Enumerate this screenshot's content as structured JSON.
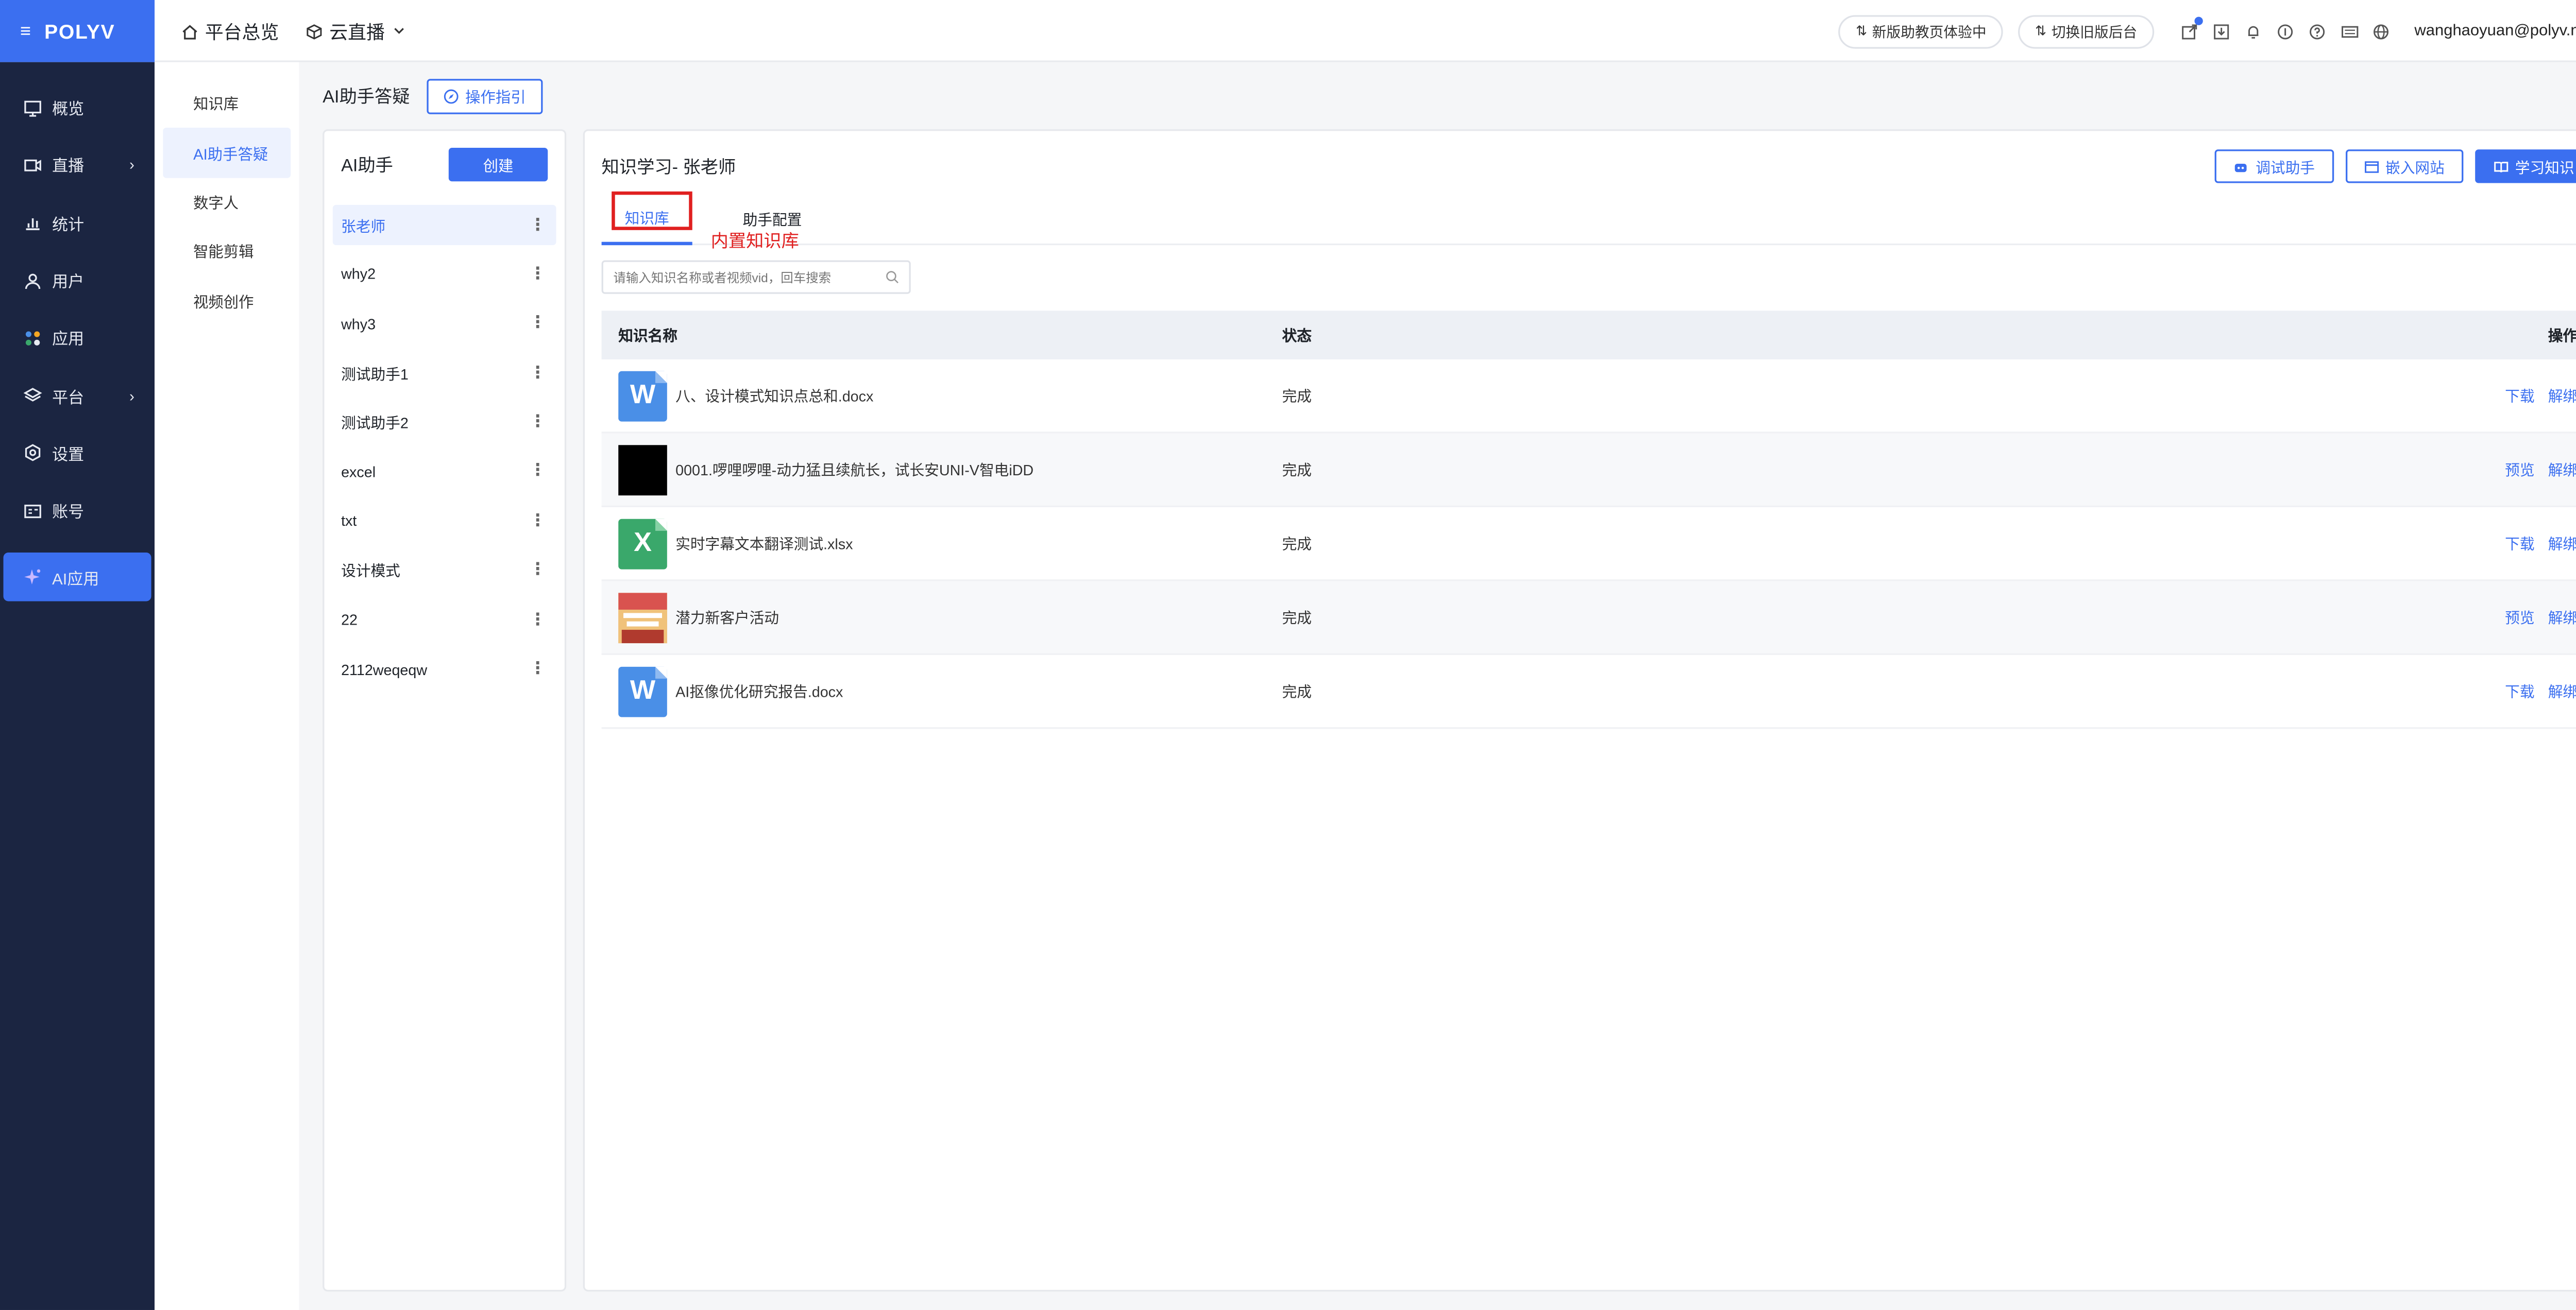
{
  "brand": {
    "menu_glyph": "≡",
    "logo": "POLYV"
  },
  "topnav": {
    "home": "平台总览",
    "live": "云直播"
  },
  "topright": {
    "pill1": "新版助教页体验中",
    "pill2": "切换旧版后台",
    "user": "wanghaoyuan@polyv.net",
    "icons": [
      "external-link-icon",
      "download-icon",
      "bell-icon",
      "coin-icon",
      "help-icon",
      "keyboard-icon",
      "globe-icon"
    ]
  },
  "sidebar": {
    "items": [
      {
        "label": "概览",
        "icon": "monitor-icon"
      },
      {
        "label": "直播",
        "icon": "video-icon",
        "arrow": "›"
      },
      {
        "label": "统计",
        "icon": "chart-icon"
      },
      {
        "label": "用户",
        "icon": "user-icon"
      },
      {
        "label": "应用",
        "icon": "apps-icon"
      },
      {
        "label": "平台",
        "icon": "layers-icon",
        "arrow": "›"
      },
      {
        "label": "设置",
        "icon": "settings-icon"
      },
      {
        "label": "账号",
        "icon": "id-card-icon"
      }
    ],
    "ai": {
      "label": "AI应用",
      "icon": "sparkle-icon"
    }
  },
  "subnav": {
    "items": [
      "知识库",
      "AI助手答疑",
      "数字人",
      "智能剪辑",
      "视频创作"
    ],
    "active_index": 1
  },
  "page": {
    "title": "AI助手答疑",
    "guide_button": "操作指引"
  },
  "assistants": {
    "title": "AI助手",
    "create_button": "创建",
    "items": [
      "张老师",
      "why2",
      "why3",
      "测试助手1",
      "测试助手2",
      "excel",
      "txt",
      "设计模式",
      "22",
      "2112weqeqw"
    ],
    "active_index": 0,
    "more_glyph": "⋮"
  },
  "main": {
    "title": "知识学习- 张老师",
    "buttons": {
      "debug": "调试助手",
      "embed": "嵌入网站",
      "learn": "学习知识"
    },
    "tabs": {
      "kb": "知识库",
      "config": "助手配置"
    },
    "annotation": "内置知识库",
    "search_placeholder": "请输入知识名称或者视频vid，回车搜索",
    "table": {
      "headers": {
        "name": "知识名称",
        "status": "状态",
        "ops": "操作"
      },
      "rows": [
        {
          "type": "word",
          "glyph": "W",
          "name": "八、设计模式知识点总和.docx",
          "status": "完成",
          "op1": "下载",
          "op2": "解绑"
        },
        {
          "type": "video",
          "glyph": "",
          "name": "0001.啰哩啰哩-动力猛且续航长，试长安UNI-V智电iDD",
          "status": "完成",
          "op1": "预览",
          "op2": "解绑"
        },
        {
          "type": "excel",
          "glyph": "X",
          "name": "实时字幕文本翻译测试.xlsx",
          "status": "完成",
          "op1": "下载",
          "op2": "解绑"
        },
        {
          "type": "image",
          "glyph": "",
          "name": "潜力新客户活动",
          "status": "完成",
          "op1": "预览",
          "op2": "解绑"
        },
        {
          "type": "word",
          "glyph": "W",
          "name": "AI抠像优化研究报告.docx",
          "status": "完成",
          "op1": "下载",
          "op2": "解绑"
        }
      ]
    }
  },
  "colors": {
    "accent": "#3b6ff0",
    "sidebar_bg": "#1b2541",
    "annotation_red": "#e02020"
  }
}
